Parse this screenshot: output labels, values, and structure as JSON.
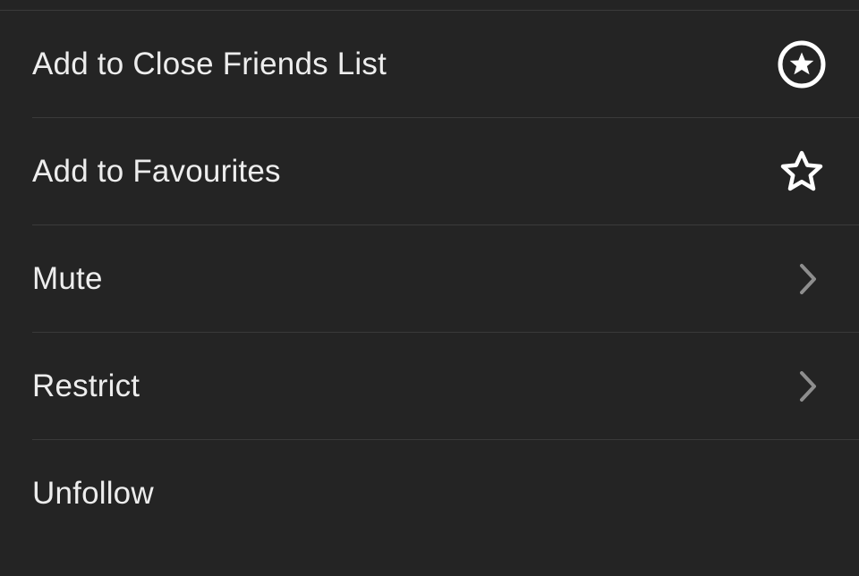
{
  "menu": {
    "items": [
      {
        "label": "Add to Close Friends List",
        "icon": "star-badge"
      },
      {
        "label": "Add to Favourites",
        "icon": "star-outline"
      },
      {
        "label": "Mute",
        "icon": "chevron"
      },
      {
        "label": "Restrict",
        "icon": "chevron"
      },
      {
        "label": "Unfollow",
        "icon": "none"
      }
    ]
  },
  "colors": {
    "background": "#242424",
    "text": "#ededed",
    "divider": "#3a3a3a",
    "iconPrimary": "#ffffff",
    "chevron": "#8e8e8e"
  }
}
